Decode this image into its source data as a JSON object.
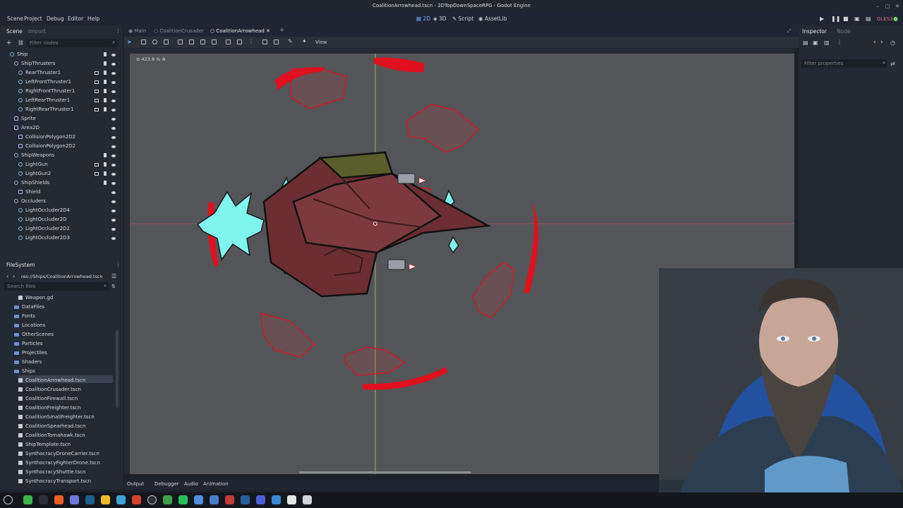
{
  "window": {
    "title": "CoalitionArrowhead.tscn - 2DTopDownSpaceRPG - Godot Engine",
    "controls": [
      "–",
      "▢",
      "✕"
    ]
  },
  "menu": [
    "Scene",
    "Project",
    "Debug",
    "Editor",
    "Help"
  ],
  "modes": [
    {
      "label": "2D",
      "active": true
    },
    {
      "label": "3D",
      "active": false
    },
    {
      "label": "Script",
      "active": false
    },
    {
      "label": "AssetLib",
      "active": false
    }
  ],
  "renderer": "GLES3",
  "scene_dock": {
    "tabs": [
      "Scene",
      "Import"
    ],
    "filter_placeholder": "Filter nodes",
    "nodes": [
      {
        "label": "Ship",
        "depth": 0
      },
      {
        "label": "ShipThrusters",
        "depth": 1
      },
      {
        "label": "RearThruster1",
        "depth": 2
      },
      {
        "label": "LeftFrontThruster1",
        "depth": 2
      },
      {
        "label": "RightFrontThruster1",
        "depth": 2
      },
      {
        "label": "LeftRearThruster1",
        "depth": 2
      },
      {
        "label": "RightRearThruster1",
        "depth": 2
      },
      {
        "label": "Sprite",
        "depth": 1
      },
      {
        "label": "Area2D",
        "depth": 1
      },
      {
        "label": "CollisionPolygon2D2",
        "depth": 2
      },
      {
        "label": "CollisionPolygon2D2",
        "depth": 2
      },
      {
        "label": "ShipWeapons",
        "depth": 1
      },
      {
        "label": "LightGun",
        "depth": 2
      },
      {
        "label": "LightGun2",
        "depth": 2
      },
      {
        "label": "ShipShields",
        "depth": 1
      },
      {
        "label": "Shield",
        "depth": 2
      },
      {
        "label": "Occluders",
        "depth": 1
      },
      {
        "label": "LightOccluder2D4",
        "depth": 2
      },
      {
        "label": "LightOccluder2D",
        "depth": 2
      },
      {
        "label": "LightOccluder2D2",
        "depth": 2
      },
      {
        "label": "LightOccluder2D3",
        "depth": 2
      }
    ]
  },
  "filesystem": {
    "title": "FileSystem",
    "path": "res://Ships/CoalitionArrowhead.tscn",
    "search_placeholder": "Search files",
    "items": [
      {
        "label": "Weapon.gd",
        "kind": "file",
        "depth": 2
      },
      {
        "label": "DataFiles",
        "kind": "folder",
        "depth": 1
      },
      {
        "label": "Fonts",
        "kind": "folder",
        "depth": 1
      },
      {
        "label": "Locations",
        "kind": "folder",
        "depth": 1
      },
      {
        "label": "OtherScenes",
        "kind": "folder",
        "depth": 1
      },
      {
        "label": "Particles",
        "kind": "folder",
        "depth": 1
      },
      {
        "label": "Projectiles",
        "kind": "folder",
        "depth": 1
      },
      {
        "label": "Shaders",
        "kind": "folder",
        "depth": 1
      },
      {
        "label": "Ships",
        "kind": "folder",
        "depth": 1
      },
      {
        "label": "CoalitionArrowhead.tscn",
        "kind": "file",
        "depth": 2,
        "selected": true
      },
      {
        "label": "CoalitionCrusader.tscn",
        "kind": "file",
        "depth": 2
      },
      {
        "label": "CoalitionFirewall.tscn",
        "kind": "file",
        "depth": 2
      },
      {
        "label": "CoalitionFreighter.tscn",
        "kind": "file",
        "depth": 2
      },
      {
        "label": "CoalitionSmallFreighter.tscn",
        "kind": "file",
        "depth": 2
      },
      {
        "label": "CoalitionSpearhead.tscn",
        "kind": "file",
        "depth": 2
      },
      {
        "label": "CoalitionTomahawk.tscn",
        "kind": "file",
        "depth": 2
      },
      {
        "label": "ShipTemplate.tscn",
        "kind": "file",
        "depth": 2
      },
      {
        "label": "SynthocracyDroneCarrier.tscn",
        "kind": "file",
        "depth": 2
      },
      {
        "label": "SynthocracyFighterDrone.tscn",
        "kind": "file",
        "depth": 2
      },
      {
        "label": "SynthocracyShuttle.tscn",
        "kind": "file",
        "depth": 2
      },
      {
        "label": "SynthocracyTransport.tscn",
        "kind": "file",
        "depth": 2
      }
    ]
  },
  "scene_tabs": [
    {
      "label": "Main",
      "active": false
    },
    {
      "label": "CoalitionCrusader",
      "active": false
    },
    {
      "label": "CoalitionArrowhead",
      "active": true
    }
  ],
  "toolbar": {
    "view_label": "View"
  },
  "viewport": {
    "zoom": "423.8 %"
  },
  "bottom_tabs": [
    "Output",
    "Debugger",
    "Audio",
    "Animation"
  ],
  "inspector": {
    "tabs": [
      "Inspector",
      "Node"
    ],
    "filter_placeholder": "Filter properties"
  },
  "colors": {
    "accent": "#6fa3ff",
    "shield_red": "#e0101e",
    "thruster_cyan": "#7ff5ee",
    "hull": "#7a3a3c"
  }
}
